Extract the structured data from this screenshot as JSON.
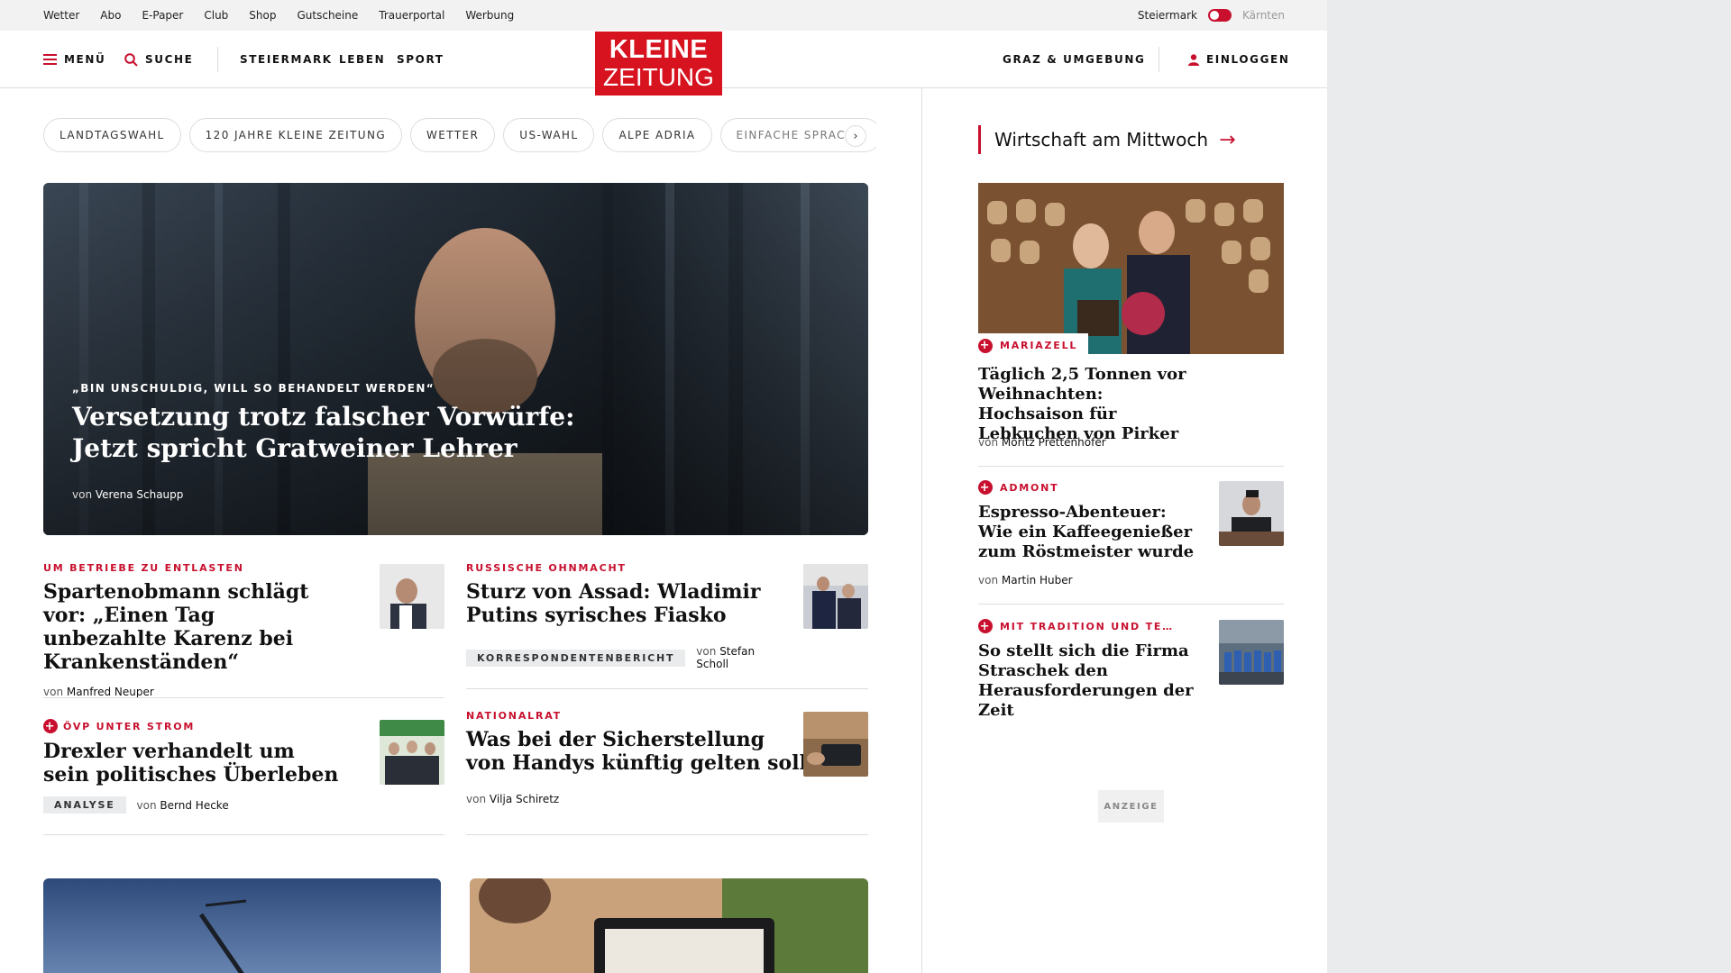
{
  "utility_bar": {
    "links": [
      "Wetter",
      "Abo",
      "E-Paper",
      "Club",
      "Shop",
      "Gutscheine",
      "Trauerportal",
      "Werbung"
    ],
    "region_active": "Steiermark",
    "region_inactive": "Kärnten"
  },
  "nav": {
    "menu_label": "MENÜ",
    "search_label": "SUCHE",
    "sections": [
      "STEIERMARK",
      "LEBEN",
      "SPORT"
    ],
    "logo_line1": "KLEINE",
    "logo_line2": "ZEITUNG",
    "region_link": "GRAZ & UMGEBUNG",
    "login_label": "EINLOGGEN"
  },
  "chips": [
    "LANDTAGSWAHL",
    "120 JAHRE KLEINE ZEITUNG",
    "WETTER",
    "US-WAHL",
    "ALPE ADRIA",
    "EINFACHE SPRACHE"
  ],
  "chip_next": "›",
  "hero": {
    "kicker": "„BIN UNSCHULDIG, WILL SO BEHANDELT WERDEN“",
    "title": "Versetzung trotz falscher Vorwürfe: Jetzt spricht Gratweiner Lehrer",
    "by_prefix": "von",
    "author": "Verena Schaupp"
  },
  "teasers": [
    {
      "kicker": "UM BETRIEBE ZU ENTLASTEN",
      "title": "Spartenobmann schlägt vor: „Einen Tag unbezahlte Karenz bei Krankenständen“",
      "by_prefix": "von",
      "author": "Manfred Neuper"
    },
    {
      "kicker": "RUSSISCHE OHNMACHT",
      "title": "Sturz von Assad: Wladimir Putins syrisches Fiasko",
      "tag": "KORRESPONDENTENBERICHT",
      "by_prefix": "von",
      "author": "Stefan Scholl"
    },
    {
      "kicker": "ÖVP UNTER STROM",
      "title": "Drexler verhandelt um sein politisches Überleben",
      "tag": "ANALYSE",
      "by_prefix": "von",
      "author": "Bernd Hecke"
    },
    {
      "kicker": "NATIONALRAT",
      "title": "Was bei der Sicherstellung von Handys künftig gelten soll",
      "by_prefix": "von",
      "author": "Vilja Schiretz"
    }
  ],
  "sidebar": {
    "heading": "Wirtschaft am Mittwoch",
    "heading_arrow": "→",
    "plus_glyph": "+",
    "articles": [
      {
        "kicker": "MARIAZELL",
        "title": "Täglich 2,5 Tonnen vor Weihnachten: Hochsaison für Lebkuchen von Pirker",
        "by_prefix": "von",
        "author": "Moritz Prettenhofer"
      },
      {
        "kicker": "ADMONT",
        "title": "Espresso-Abenteuer: Wie ein Kaffeegenießer zum Röstmeister wurde",
        "by_prefix": "von",
        "author": "Martin Huber"
      },
      {
        "kicker": "MIT TRADITION UND TE…",
        "title": "So stellt sich die Firma Straschek den Herausforderungen der Zeit"
      }
    ],
    "ad_label": "ANZEIGE"
  },
  "colors": {
    "brand_red": "#d7131f",
    "accent_red": "#c8102e"
  }
}
